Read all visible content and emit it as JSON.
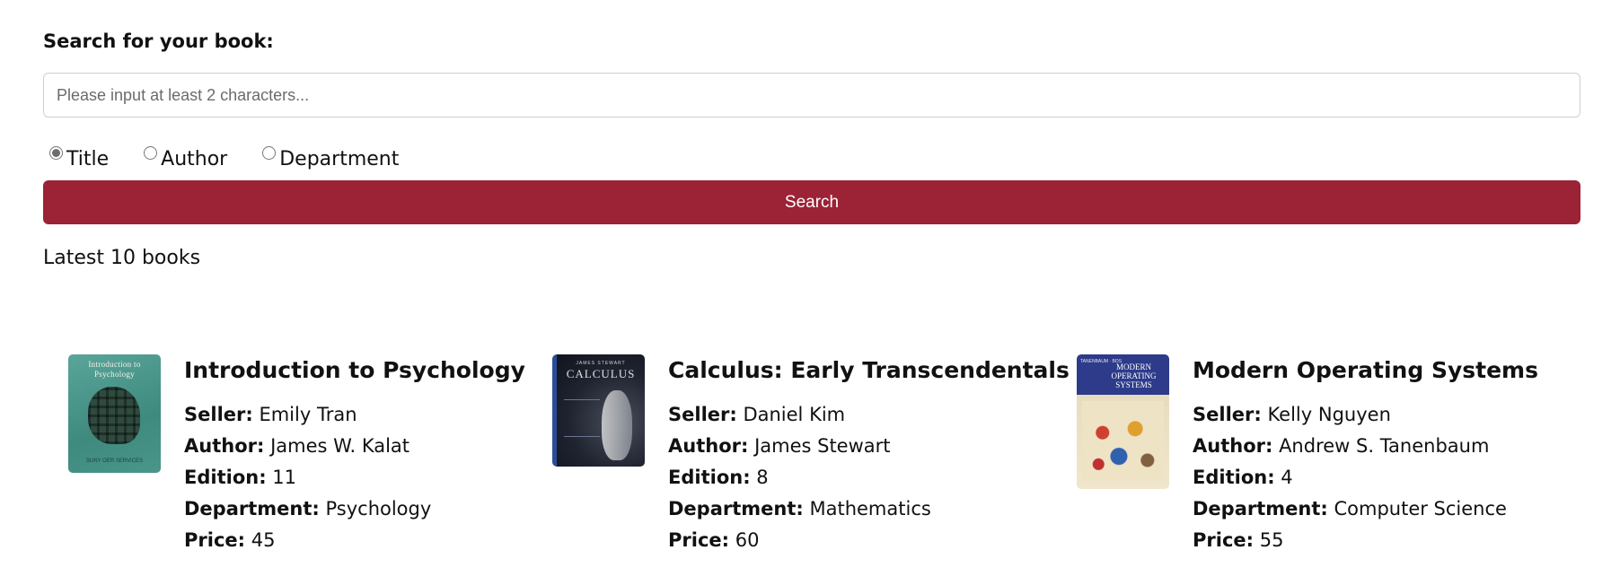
{
  "search": {
    "label": "Search for your book:",
    "placeholder": "Please input at least 2 characters...",
    "value": "",
    "options": [
      {
        "label": "Title",
        "checked": true
      },
      {
        "label": "Author",
        "checked": false
      },
      {
        "label": "Department",
        "checked": false
      }
    ],
    "button_label": "Search"
  },
  "accent_color": "#9c2235",
  "latest_heading": "Latest 10 books",
  "field_labels": {
    "seller": "Seller:",
    "author": "Author:",
    "edition": "Edition:",
    "department": "Department:",
    "price": "Price:"
  },
  "books": [
    {
      "title": "Introduction to Psychology",
      "seller": "Emily Tran",
      "author": "James W. Kalat",
      "edition": "11",
      "department": "Psychology",
      "price": "45",
      "cover": {
        "title_line1": "Introduction to",
        "title_line2": "Psychology",
        "author": "SUNY OER SERVICES"
      }
    },
    {
      "title": "Calculus: Early Transcendentals",
      "seller": "Daniel Kim",
      "author": "James Stewart",
      "edition": "8",
      "department": "Mathematics",
      "price": "60",
      "cover": {
        "author": "JAMES STEWART",
        "title": "CALCULUS"
      }
    },
    {
      "title": "Modern Operating Systems",
      "seller": "Kelly Nguyen",
      "author": "Andrew S. Tanenbaum",
      "edition": "4",
      "department": "Computer Science",
      "price": "55",
      "cover": {
        "author": "TANENBAUM · BOS",
        "title_line1": "MODERN",
        "title_line2": "OPERATING",
        "title_line3": "SYSTEMS"
      }
    }
  ]
}
